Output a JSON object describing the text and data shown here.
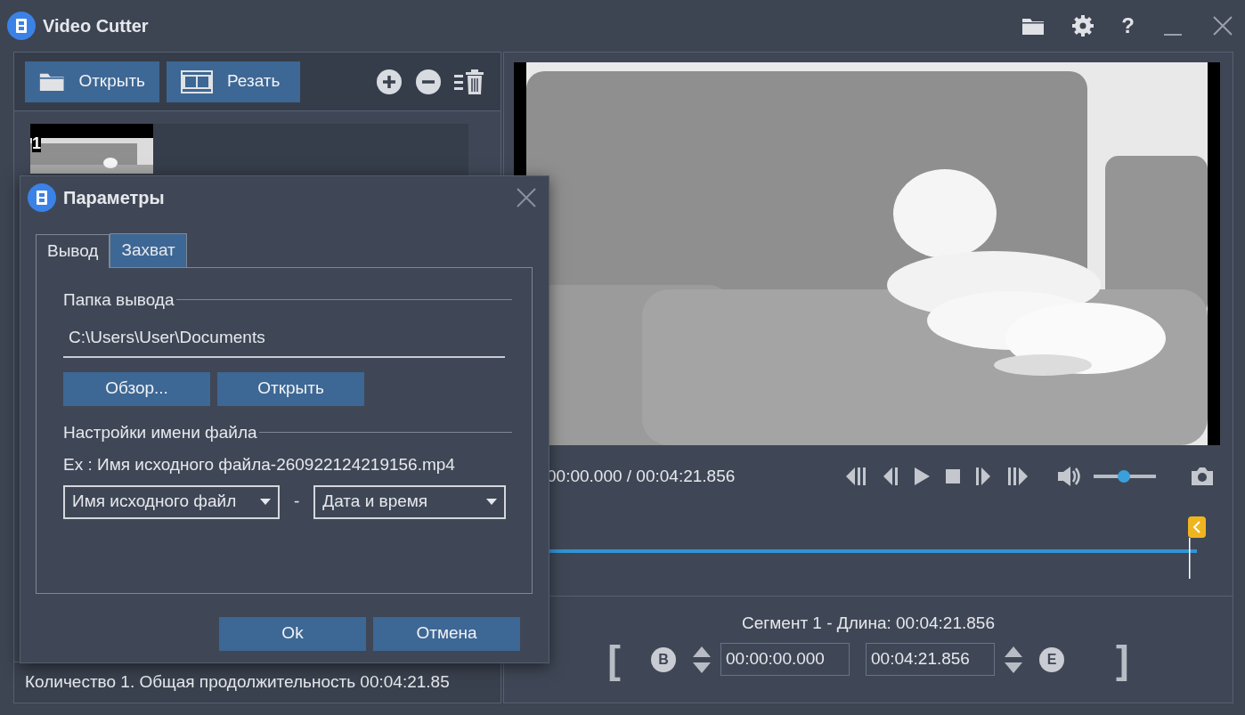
{
  "window": {
    "title": "Video Cutter",
    "help_button": "?"
  },
  "toolbar": {
    "buttons": [
      {
        "kind": "open",
        "label": "Открыть"
      },
      {
        "kind": "cut",
        "label": "Резать"
      }
    ]
  },
  "file_list": [
    {
      "number": "1"
    }
  ],
  "status_bar": "Количество 1. Общая продолжительность 00:04:21.85",
  "player": {
    "time": "00:00.000 / 00:04:21.856",
    "volume": {
      "level": 0.48
    }
  },
  "segment": {
    "label": "Сегмент 1 - Длина: 00:04:21.856",
    "open_bracket": "[",
    "start_mark": "B",
    "start": "00:00:00.000",
    "end": "00:04:21.856",
    "end_mark": "E",
    "close_bracket": "]"
  },
  "dialog": {
    "title": "Параметры",
    "tabs": [
      {
        "label": "Вывод",
        "selected": true
      },
      {
        "label": "Захват",
        "selected": false
      }
    ],
    "output_folder": {
      "heading": "Папка вывода",
      "path": "C:\\Users\\User\\Documents",
      "buttons": [
        "Обзор...",
        "Открыть"
      ]
    },
    "file_name": {
      "heading": "Настройки имени файла",
      "example": "Ex : Имя исходного файла-260922124219156.mp4",
      "part_1": "Имя исходного файл",
      "separator": "-",
      "part_2": "Дата и время"
    },
    "buttons": [
      "Ok",
      "Отмена"
    ]
  }
}
